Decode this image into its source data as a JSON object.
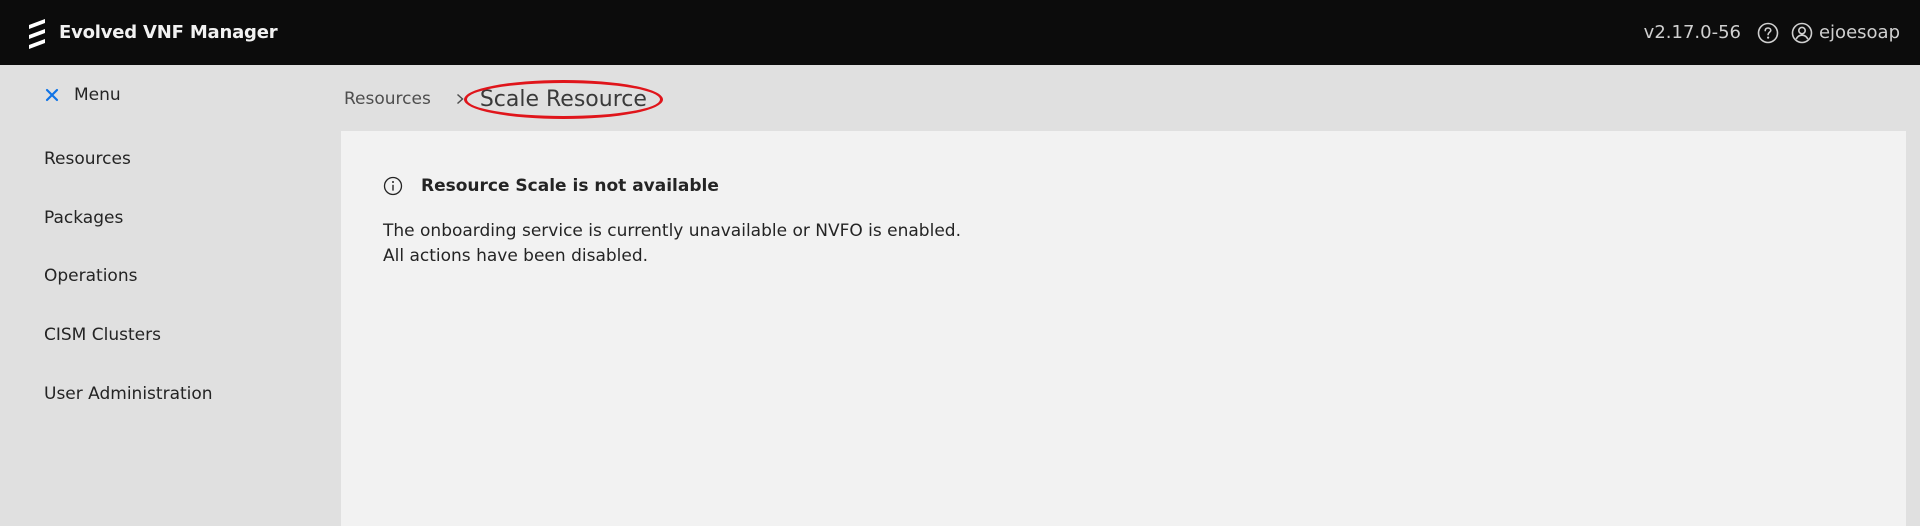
{
  "app": {
    "title": "Evolved VNF Manager",
    "version": "v2.17.0-56",
    "username": "ejoesoap"
  },
  "icons": {
    "logo": "ericsson-logo-icon",
    "help": "help-circle-icon",
    "user": "user-circle-icon",
    "close": "close-icon",
    "separator": "chevron-right-icon",
    "info": "info-circle-icon"
  },
  "colors": {
    "topbar": "#0c0c0c",
    "accent": "#1174e6",
    "highlight_ring": "#e0151b",
    "content_bg": "#f2f2f2",
    "sidebar_bg": "#e0e0e0"
  },
  "sidebar": {
    "menu_label": "Menu",
    "items": [
      {
        "label": "Resources"
      },
      {
        "label": "Packages"
      },
      {
        "label": "Operations"
      },
      {
        "label": "CISM Clusters"
      },
      {
        "label": "User Administration"
      }
    ]
  },
  "breadcrumb": {
    "parent": "Resources",
    "current": "Scale Resource"
  },
  "message": {
    "title": "Resource Scale is not available",
    "line1": "The onboarding service is currently unavailable or NVFO is enabled.",
    "line2": "All actions have been disabled."
  }
}
